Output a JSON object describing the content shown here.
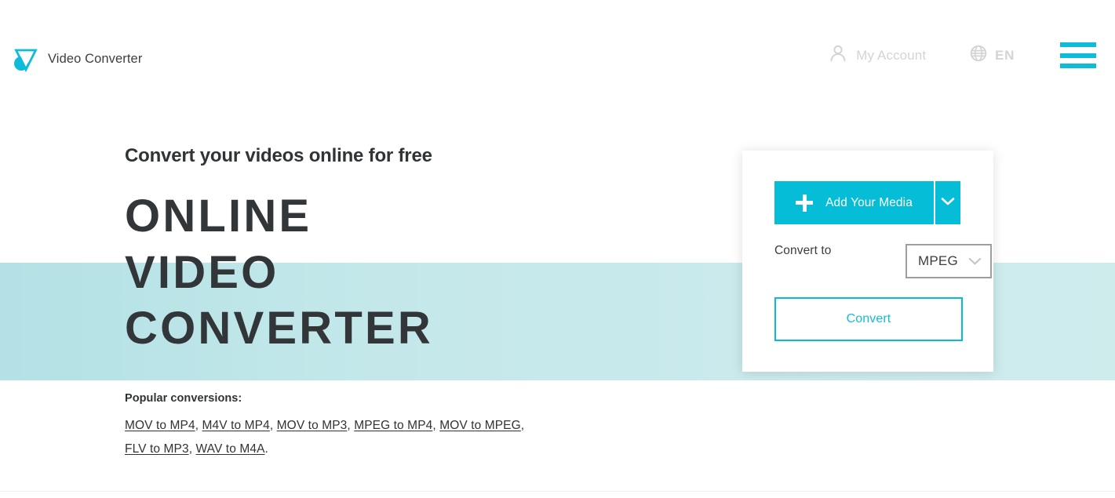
{
  "header": {
    "brand_name": "Video Converter",
    "logo_icon": "video-converter-logo-icon",
    "account_label": "My Account",
    "account_icon": "person-icon",
    "language_label": "EN",
    "language_icon": "globe-icon",
    "menu_icon": "hamburger-menu-icon"
  },
  "hero": {
    "subheading": "Convert your videos online for free",
    "title_line1": "ONLINE",
    "title_line2": "VIDEO",
    "title_line3": "CONVERTER"
  },
  "popular": {
    "title": "Popular conversions:",
    "links": [
      "MOV to MP4",
      "M4V to MP4",
      "MOV to MP3",
      "MPEG to MP4",
      "MOV to MPEG",
      "FLV to MP3",
      "WAV to M4A"
    ],
    "separator": ", ",
    "terminator": "."
  },
  "converter": {
    "add_media_label": "Add Your Media",
    "add_media_plus_icon": "plus-icon",
    "add_media_caret_icon": "chevron-down-icon",
    "convert_to_label": "Convert to",
    "format_value": "MPEG",
    "format_caret_icon": "chevron-down-icon",
    "convert_button_label": "Convert"
  },
  "colors": {
    "accent_cyan": "#05bdd6",
    "band_light": "#c4e8ea",
    "text_dark": "#323638",
    "muted_gray": "#d2d4d6"
  }
}
